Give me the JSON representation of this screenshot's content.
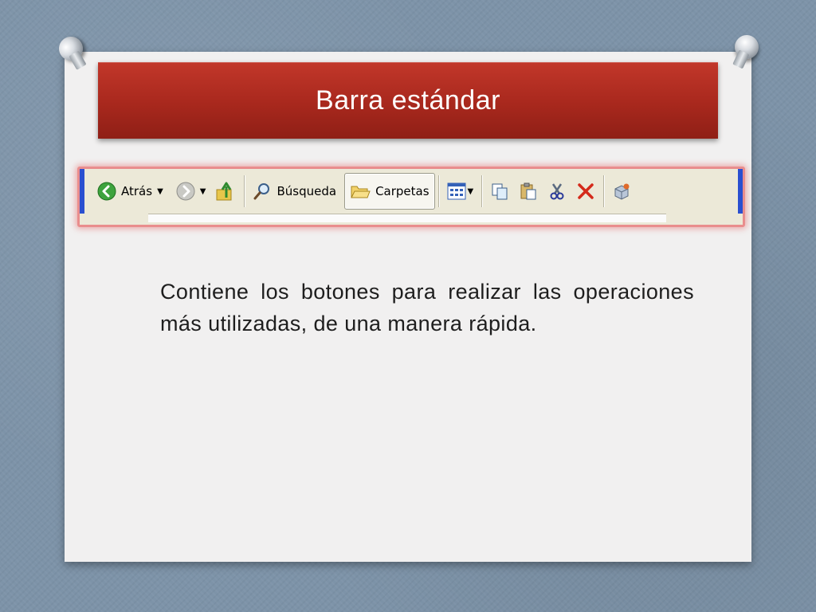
{
  "slide": {
    "title": "Barra estándar",
    "body": "Contiene los botones para realizar las operaciones más utilizadas, de una manera rápida."
  },
  "toolbar": {
    "back_label": "Atrás",
    "search_label": "Búsqueda",
    "folders_label": "Carpetas"
  },
  "colors": {
    "title_banner": "#a8281d",
    "toolbar_frame_glow": "#e98d8d",
    "toolbar_side_bar": "#2a4fd0"
  }
}
